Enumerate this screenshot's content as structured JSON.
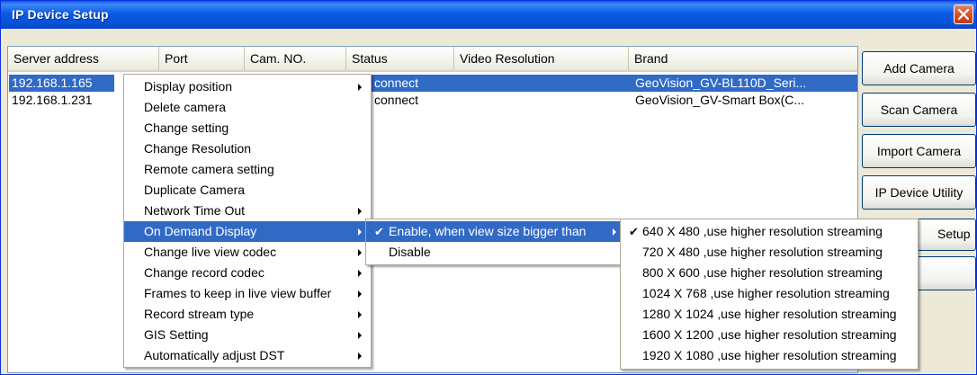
{
  "window": {
    "title": "IP Device Setup"
  },
  "table": {
    "columns": [
      "Server address",
      "Port",
      "Cam. NO.",
      "Status",
      "Video Resolution",
      "Brand"
    ],
    "rows": [
      {
        "address": "192.168.1.165",
        "status": "connect",
        "brand": "GeoVision_GV-BL110D_Seri...",
        "selected": true
      },
      {
        "address": "192.168.1.231",
        "status": "connect",
        "brand": "GeoVision_GV-Smart Box(C...",
        "selected": false
      }
    ]
  },
  "buttons": {
    "add": "Add Camera",
    "scan": "Scan Camera",
    "import": "Import Camera",
    "utility": "IP Device Utility",
    "setup_partial": "Setup"
  },
  "context_menu": {
    "items": [
      "Display position",
      "Delete camera",
      "Change setting",
      "Change Resolution",
      "Remote camera setting",
      "Duplicate Camera",
      "Network Time Out",
      "On Demand Display",
      "Change live view codec",
      "Change record codec",
      "Frames to keep in live view buffer",
      "Record stream type",
      "GIS Setting",
      "Automatically adjust DST"
    ]
  },
  "on_demand_menu": {
    "items": [
      "Enable, when view size bigger than",
      "Disable"
    ]
  },
  "resolution_menu": {
    "items": [
      "640 X 480 ,use higher resolution streaming",
      "720 X 480 ,use higher resolution streaming",
      "800 X 600 ,use higher resolution streaming",
      "1024 X 768 ,use higher resolution streaming",
      "1280 X 1024 ,use higher resolution streaming",
      "1600 X 1200 ,use higher resolution streaming",
      "1920 X 1080 ,use higher resolution streaming"
    ]
  },
  "check_glyph": "✔",
  "colors": {
    "selection": "#316ac5",
    "titlebar": "#0a5ce4",
    "close": "#d6502a"
  }
}
